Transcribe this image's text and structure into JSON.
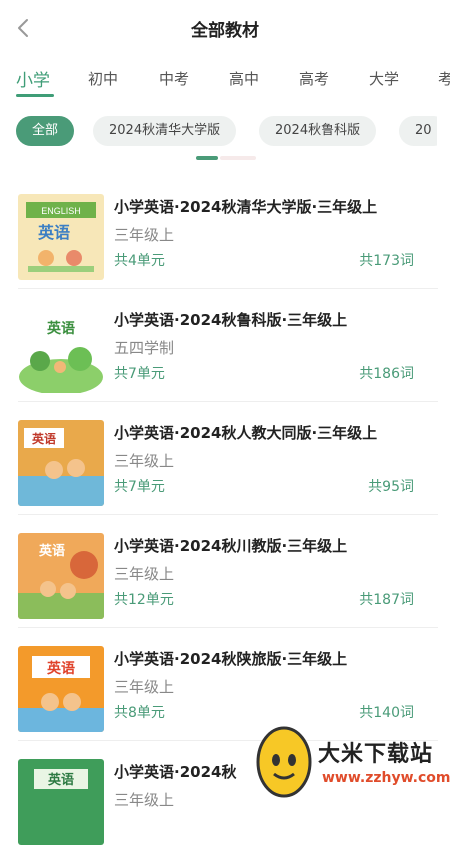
{
  "header": {
    "title": "全部教材",
    "back_icon": "chevron-left-icon"
  },
  "level_tabs": [
    {
      "label": "小学",
      "active": true
    },
    {
      "label": "初中",
      "active": false
    },
    {
      "label": "中考",
      "active": false
    },
    {
      "label": "高中",
      "active": false
    },
    {
      "label": "高考",
      "active": false
    },
    {
      "label": "大学",
      "active": false
    },
    {
      "label": "考",
      "active": false
    }
  ],
  "chips": [
    {
      "label": "全部",
      "active": true
    },
    {
      "label": "2024秋清华大学版",
      "active": false
    },
    {
      "label": "2024秋鲁科版",
      "active": false
    },
    {
      "label": "20",
      "active": false
    }
  ],
  "books": [
    {
      "title": "小学英语·2024秋清华大学版·三年级上",
      "subtitle": "三年级上",
      "units": "共4单元",
      "words": "共173词",
      "cover_text": "英语",
      "cover_sub": "ENGLISH"
    },
    {
      "title": "小学英语·2024秋鲁科版·三年级上",
      "subtitle": "五四学制",
      "units": "共7单元",
      "words": "共186词",
      "cover_text": "英语"
    },
    {
      "title": "小学英语·2024秋人教大同版·三年级上",
      "subtitle": "三年级上",
      "units": "共7单元",
      "words": "共95词",
      "cover_text": "英语"
    },
    {
      "title": "小学英语·2024秋川教版·三年级上",
      "subtitle": "三年级上",
      "units": "共12单元",
      "words": "共187词",
      "cover_text": "英语"
    },
    {
      "title": "小学英语·2024秋陕旅版·三年级上",
      "subtitle": "三年级上",
      "units": "共8单元",
      "words": "共140词",
      "cover_text": "英语"
    },
    {
      "title": "小学英语·2024秋",
      "subtitle": "三年级上",
      "units": "",
      "words": "",
      "cover_text": "英语"
    }
  ],
  "watermark": {
    "name": "大米下载站",
    "url": "www.zzhyw.com"
  },
  "colors": {
    "accent": "#4a9b78",
    "chip_bg": "#eef1f0",
    "muted": "#888888"
  }
}
